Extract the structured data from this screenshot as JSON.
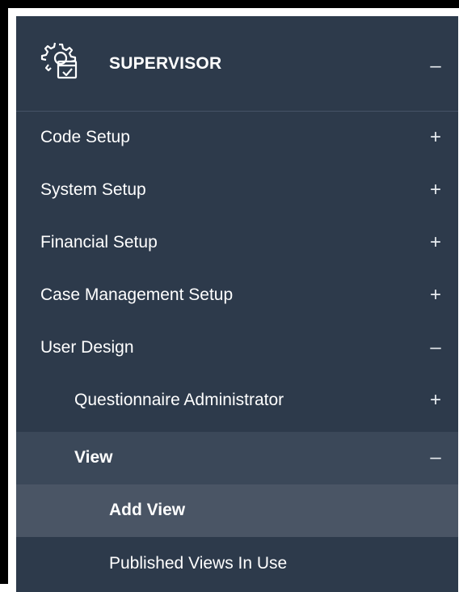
{
  "menu": {
    "header": {
      "title": "SUPERVISOR",
      "icon": "gear-checklist-icon",
      "toggle": "–"
    },
    "items": [
      {
        "label": "Code Setup",
        "toggle": "+"
      },
      {
        "label": "System Setup",
        "toggle": "+"
      },
      {
        "label": "Financial Setup",
        "toggle": "+"
      },
      {
        "label": "Case Management Setup",
        "toggle": "+"
      },
      {
        "label": "User Design",
        "toggle": "–"
      },
      {
        "label": "Questionnaire Administrator",
        "toggle": "+"
      },
      {
        "label": "View",
        "toggle": "–"
      },
      {
        "label": "Add View",
        "toggle": ""
      },
      {
        "label": "Published Views In Use",
        "toggle": ""
      }
    ]
  },
  "colors": {
    "background": "#2d3a4b",
    "view_highlight": "#3b4859",
    "add_view_highlight": "#4a5565",
    "text": "#ffffff"
  }
}
